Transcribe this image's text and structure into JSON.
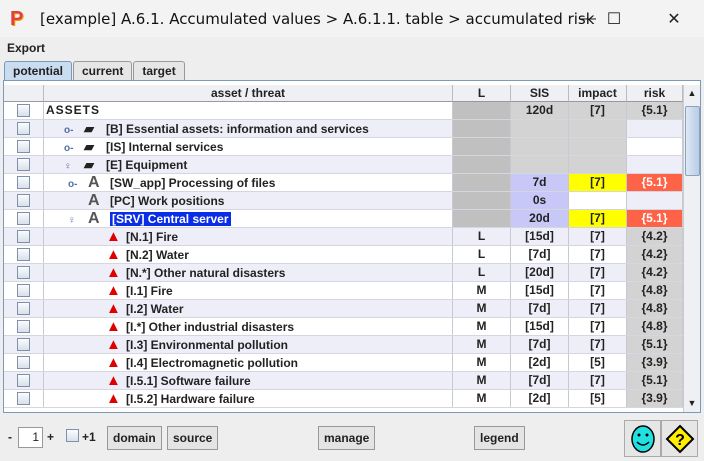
{
  "window": {
    "title": "[example] A.6.1. Accumulated values > A.6.1.1. table > accumulated risk",
    "minimize": "—",
    "maximize": "☐",
    "close": "✕"
  },
  "menu": {
    "export": "Export"
  },
  "tabs": [
    {
      "label": "potential",
      "active": true
    },
    {
      "label": "current"
    },
    {
      "label": "target"
    }
  ],
  "columns": {
    "asset": "asset / threat",
    "L": "L",
    "SIS": "SIS",
    "impact": "impact",
    "risk": "risk"
  },
  "rows": [
    {
      "kind": "root",
      "label": "ASSETS",
      "L": "",
      "SIS": "120d",
      "impact": "[7]",
      "risk": "{5.1}"
    },
    {
      "kind": "group",
      "indent": 0,
      "expander": "closed",
      "label": "[B] Essential assets: information and services",
      "L": "",
      "SIS": "",
      "impact": "",
      "risk": ""
    },
    {
      "kind": "group",
      "indent": 0,
      "expander": "closed",
      "label": "[IS] Internal services",
      "L": "",
      "SIS": "",
      "impact": "",
      "risk": ""
    },
    {
      "kind": "group",
      "indent": 0,
      "expander": "open",
      "label": "[E] Equipment",
      "L": "",
      "SIS": "",
      "impact": "",
      "risk": ""
    },
    {
      "kind": "asset",
      "indent": 1,
      "expander": "closed",
      "label": "[SW_app] Processing of files",
      "L": "",
      "SIS": "7d",
      "impact": "[7]",
      "risk": "{5.1}"
    },
    {
      "kind": "asset",
      "indent": 1,
      "expander": "none",
      "label": "[PC] Work positions",
      "L": "",
      "SIS": "0s",
      "impact": "",
      "risk": ""
    },
    {
      "kind": "asset",
      "indent": 1,
      "expander": "open",
      "label": "[SRV] Central server",
      "selected": true,
      "L": "",
      "SIS": "20d",
      "impact": "[7]",
      "risk": "{5.1}"
    },
    {
      "kind": "threat",
      "label": "[N.1] Fire",
      "L": "L",
      "SIS": "[15d]",
      "impact": "[7]",
      "risk": "{4.2}"
    },
    {
      "kind": "threat",
      "label": "[N.2] Water",
      "L": "L",
      "SIS": "[7d]",
      "impact": "[7]",
      "risk": "{4.2}"
    },
    {
      "kind": "threat",
      "label": "[N.*] Other natural disasters",
      "L": "L",
      "SIS": "[20d]",
      "impact": "[7]",
      "risk": "{4.2}"
    },
    {
      "kind": "threat",
      "label": "[I.1] Fire",
      "L": "M",
      "SIS": "[15d]",
      "impact": "[7]",
      "risk": "{4.8}"
    },
    {
      "kind": "threat",
      "label": "[I.2] Water",
      "L": "M",
      "SIS": "[7d]",
      "impact": "[7]",
      "risk": "{4.8}"
    },
    {
      "kind": "threat",
      "label": "[I.*] Other industrial disasters",
      "L": "M",
      "SIS": "[15d]",
      "impact": "[7]",
      "risk": "{4.8}"
    },
    {
      "kind": "threat",
      "label": "[I.3] Environmental pollution",
      "L": "M",
      "SIS": "[7d]",
      "impact": "[7]",
      "risk": "{5.1}"
    },
    {
      "kind": "threat",
      "label": "[I.4] Electromagnetic pollution",
      "L": "M",
      "SIS": "[2d]",
      "impact": "[5]",
      "risk": "{3.9}"
    },
    {
      "kind": "threat",
      "label": "[I.5.1] Software failure",
      "L": "M",
      "SIS": "[7d]",
      "impact": "[7]",
      "risk": "{5.1}"
    },
    {
      "kind": "threat",
      "label": "[I.5.2] Hardware failure",
      "L": "M",
      "SIS": "[2d]",
      "impact": "[5]",
      "risk": "{3.9}"
    }
  ],
  "bottom": {
    "minus": "-",
    "level": "1",
    "plus": "+",
    "plus1": "+1",
    "domain": "domain",
    "source": "source",
    "manage": "manage",
    "legend": "legend"
  },
  "colors": {
    "highlight_impact": "#ffff00",
    "highlight_risk": "#ff6347",
    "sis": "#c8c8f8",
    "gray": "#d3d3d3",
    "lgray": "#c0c0c0",
    "selected": "#0a2de8"
  }
}
